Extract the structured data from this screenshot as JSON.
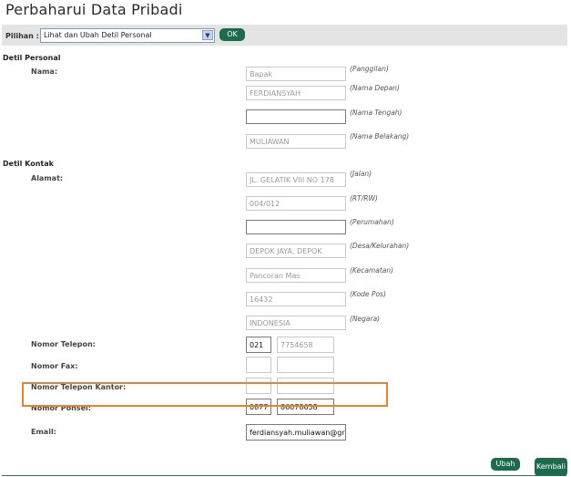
{
  "page": {
    "title": "Perbaharui Data Pribadi"
  },
  "selector": {
    "label": "Pilihan :",
    "value": "Lihat dan Ubah Detil Personal",
    "ok_label": "OK"
  },
  "sections": {
    "personal": "Detil Personal",
    "kontak": "Detil Kontak"
  },
  "labels": {
    "nama": "Nama:",
    "alamat": "Alamat:",
    "telepon": "Nomor Telepon:",
    "fax": "Nomor Fax:",
    "telepon_kantor": "Nomor Telepon Kantor:",
    "ponsel": "Nomor Ponsel:",
    "email": "Email:"
  },
  "fields": {
    "panggilan": {
      "value": "Bapak",
      "hint": "(Panggilan)"
    },
    "nama_depan": {
      "value": "FERDIANSYAH",
      "hint": "(Nama Depan)"
    },
    "nama_tengah": {
      "value": "",
      "hint": "(Nama Tengah)"
    },
    "nama_belakang": {
      "value": "MULIAWAN",
      "hint": "(Nama Belakang)"
    },
    "jalan": {
      "value": "JL. GELATIK VIII NO 178",
      "hint": "(Jalan)"
    },
    "rtrw": {
      "value": "004/012",
      "hint": "(RT/RW)"
    },
    "perumahan": {
      "value": "",
      "hint": "(Perumahan)"
    },
    "desa": {
      "value": "DEPOK JAYA, DEPOK",
      "hint": "(Desa/Kelurahan)"
    },
    "kecamatan": {
      "value": "Pancoran Mas",
      "hint": "(Kecamatan)"
    },
    "kode_pos": {
      "value": "16432",
      "hint": "(Kode Pos)"
    },
    "negara": {
      "value": "INDONESIA",
      "hint": "(Negara)"
    },
    "telepon_area": {
      "value": "021"
    },
    "telepon_nomor": {
      "value": "7754658"
    },
    "fax_area": {
      "value": ""
    },
    "fax_nomor": {
      "value": ""
    },
    "kantor_area": {
      "value": ""
    },
    "kantor_nomor": {
      "value": ""
    },
    "ponsel_area": {
      "value": "0877"
    },
    "ponsel_nomor": {
      "value": "86078658"
    },
    "email": {
      "value": "ferdiansyah.muliawan@gr"
    }
  },
  "actions": {
    "ubah": "Ubah",
    "kembali": "Kembali"
  },
  "colors": {
    "button": "#1d6b4d",
    "highlight": "#e2852f",
    "bar": "#e4e4e4"
  }
}
